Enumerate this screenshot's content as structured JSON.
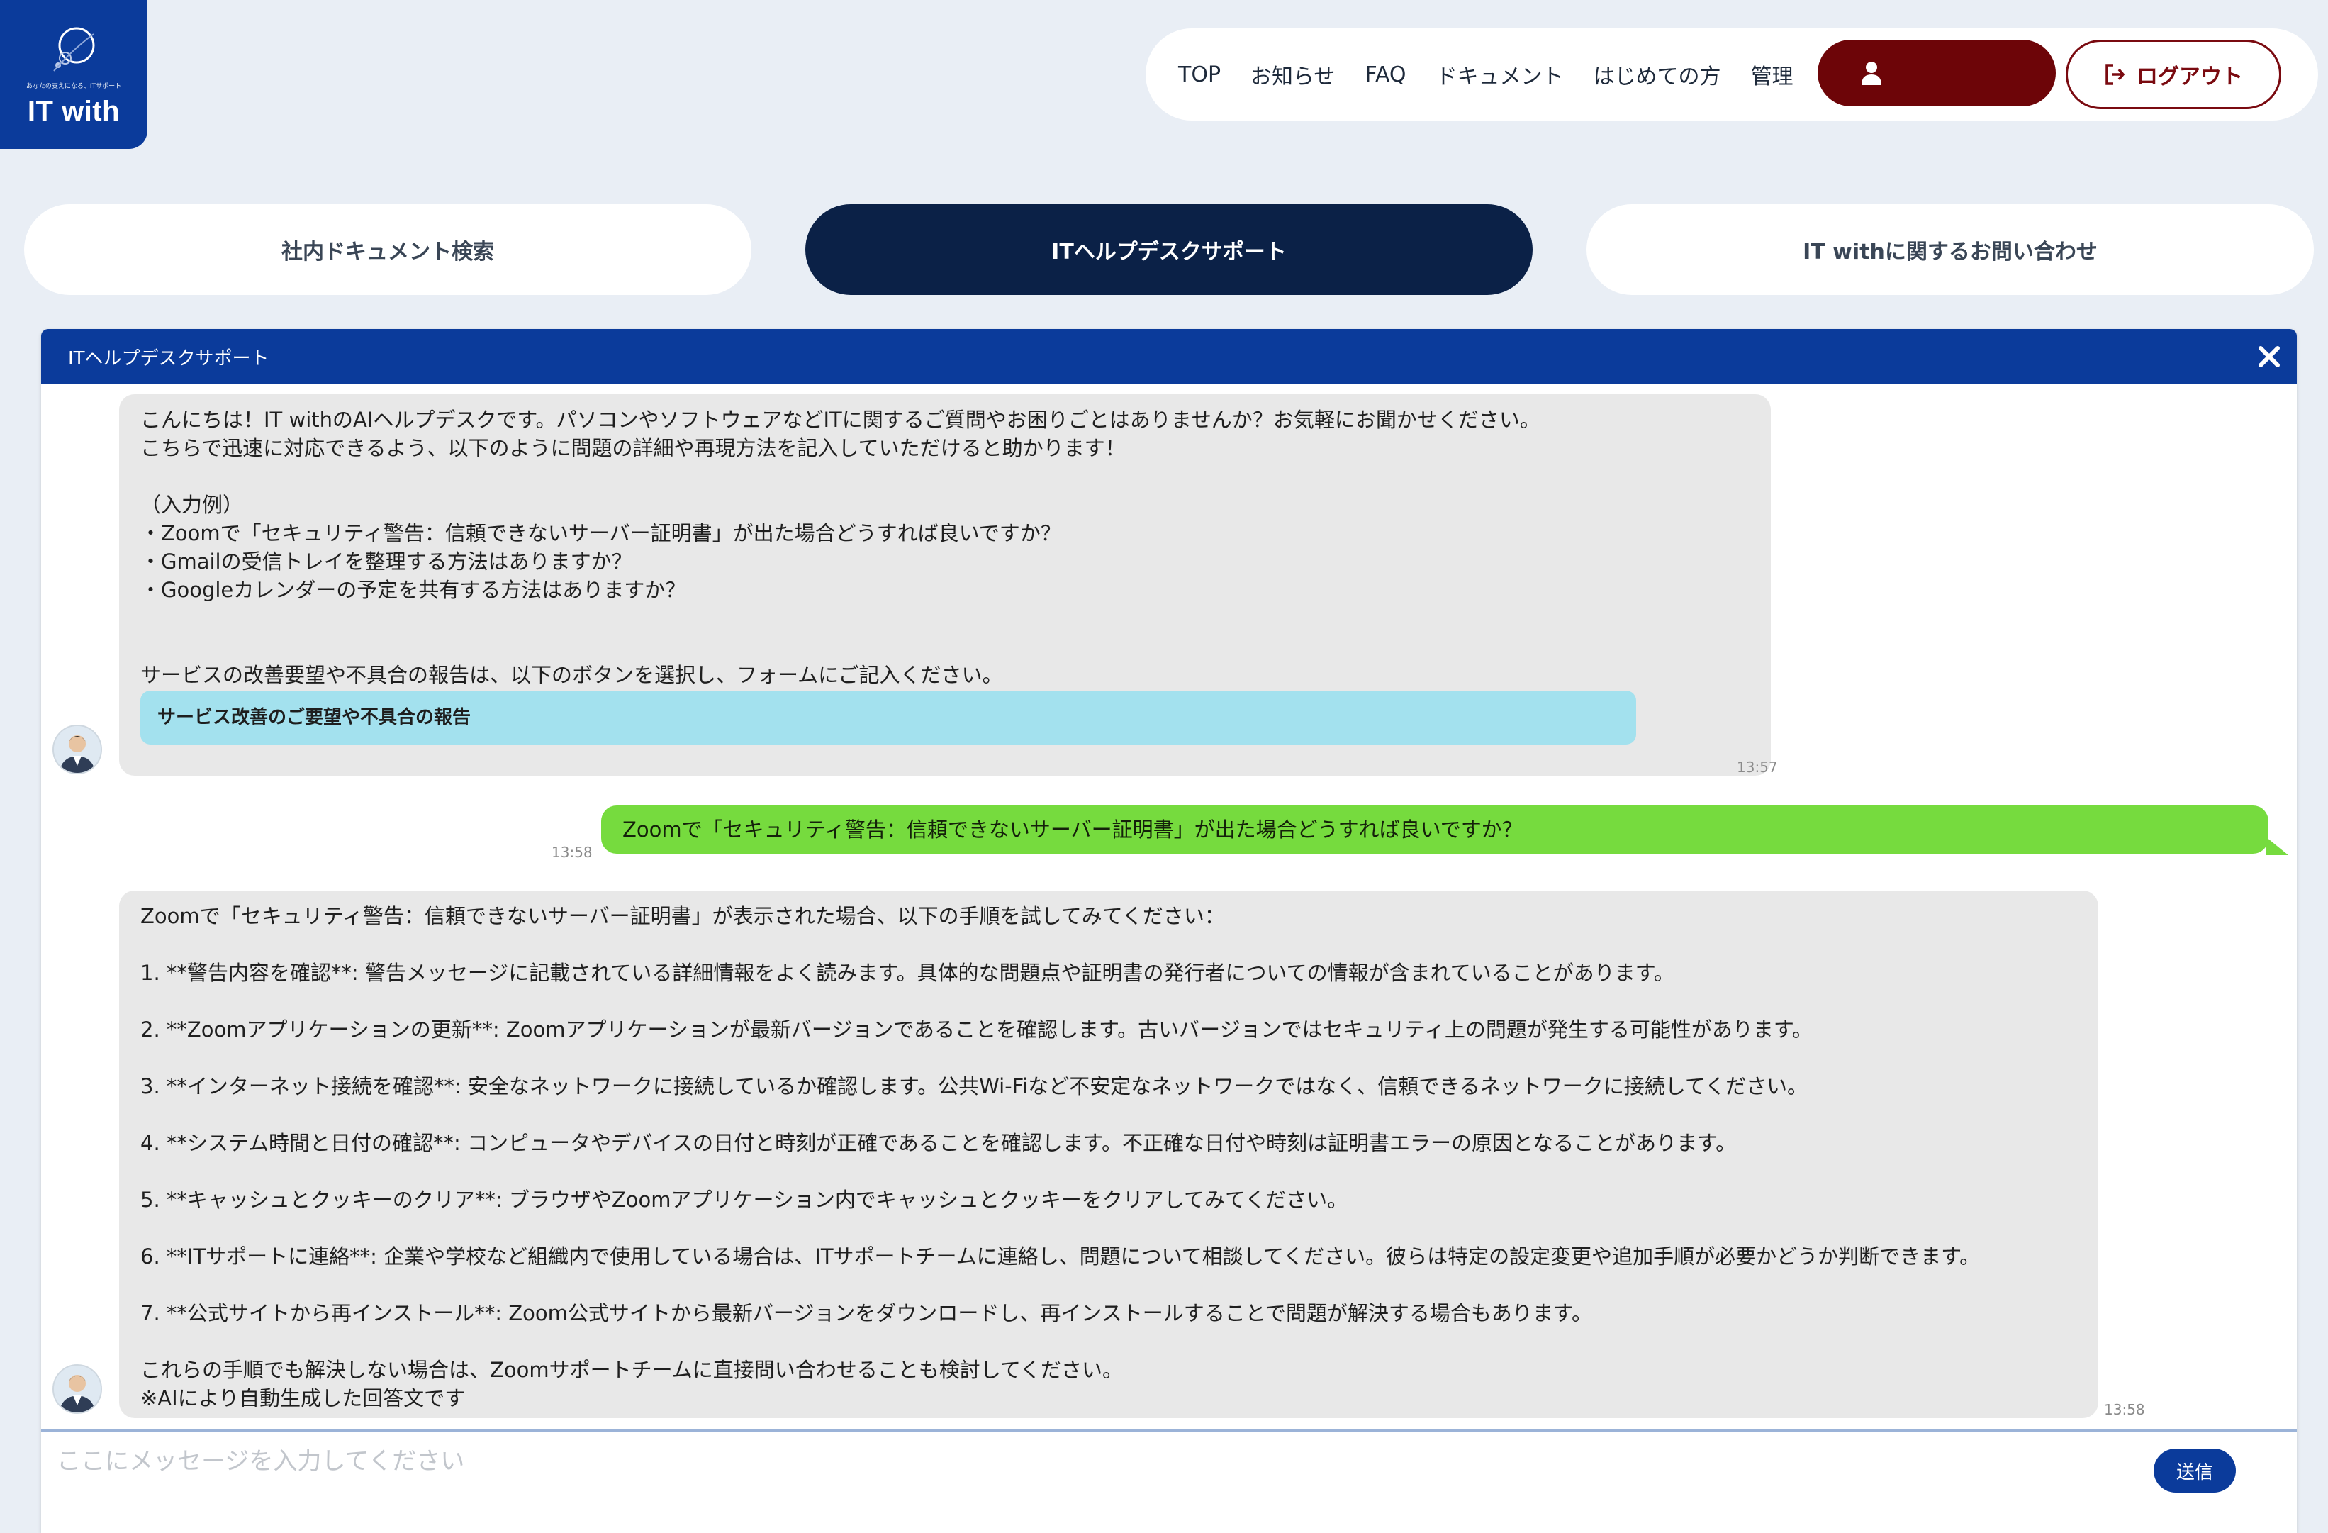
{
  "logo": {
    "tagline": "あなたの支えになる、ITサポート",
    "name": "IT with"
  },
  "nav": {
    "links": [
      "TOP",
      "お知らせ",
      "FAQ",
      "ドキュメント",
      "はじめての方",
      "管理"
    ],
    "logout_label": "ログアウト"
  },
  "tabs": [
    {
      "label": "社内ドキュメント検索",
      "active": false
    },
    {
      "label": "ITヘルプデスクサポート",
      "active": true
    },
    {
      "label": "IT withに関するお問い合わせ",
      "active": false
    }
  ],
  "chat": {
    "title": "ITヘルプデスクサポート",
    "messages": [
      {
        "role": "bot",
        "time": "13:57",
        "lines": [
          "こんにちは！IT withのAIヘルプデスクです。パソコンやソフトウェアなどITに関するご質問やお困りごとはありませんか？お気軽にお聞かせください。",
          "こちらで迅速に対応できるよう、以下のように問題の詳細や再現方法を記入していただけると助かります！",
          "",
          "（入力例）",
          "・Zoomで「セキュリティ警告：信頼できないサーバー証明書」が出た場合どうすれば良いですか？",
          "・Gmailの受信トレイを整理する方法はありますか？",
          "・Googleカレンダーの予定を共有する方法はありますか？",
          "",
          "",
          "サービスの改善要望や不具合の報告は、以下のボタンを選択し、フォームにご記入ください。"
        ],
        "button_label": "サービス改善のご要望や不具合の報告"
      },
      {
        "role": "user",
        "time": "13:58",
        "text": "Zoomで「セキュリティ警告：信頼できないサーバー証明書」が出た場合どうすれば良いですか？"
      },
      {
        "role": "bot",
        "time": "13:58",
        "lines": [
          "Zoomで「セキュリティ警告：信頼できないサーバー証明書」が表示された場合、以下の手順を試してみてください：",
          "",
          "1. **警告内容を確認**: 警告メッセージに記載されている詳細情報をよく読みます。具体的な問題点や証明書の発行者についての情報が含まれていることがあります。",
          "",
          "2. **Zoomアプリケーションの更新**: Zoomアプリケーションが最新バージョンであることを確認します。古いバージョンではセキュリティ上の問題が発生する可能性があります。",
          "",
          "3. **インターネット接続を確認**: 安全なネットワークに接続しているか確認します。公共Wi-Fiなど不安定なネットワークではなく、信頼できるネットワークに接続してください。",
          "",
          "4. **システム時間と日付の確認**: コンピュータやデバイスの日付と時刻が正確であることを確認します。不正確な日付や時刻は証明書エラーの原因となることがあります。",
          "",
          "5. **キャッシュとクッキーのクリア**: ブラウザやZoomアプリケーション内でキャッシュとクッキーをクリアしてみてください。",
          "",
          "6. **ITサポートに連絡**: 企業や学校など組織内で使用している場合は、ITサポートチームに連絡し、問題について相談してください。彼らは特定の設定変更や追加手順が必要かどうか判断できます。",
          "",
          "7. **公式サイトから再インストール**: Zoom公式サイトから最新バージョンをダウンロードし、再インストールすることで問題が解決する場合もあります。",
          "",
          "これらの手順でも解決しない場合は、Zoomサポートチームに直接問い合わせることも検討してください。",
          "※AIにより自動生成した回答文です"
        ]
      }
    ],
    "input_placeholder": "ここにメッセージを入力してください",
    "input_value": "",
    "send_label": "送信"
  },
  "colors": {
    "brand_blue": "#0b3b9b",
    "navy": "#0b2147",
    "logout_red": "#7a0a10",
    "user_bubble": "#76db3e",
    "bot_bubble": "#e8e8e8",
    "report_button": "#a3e1ee"
  },
  "icons": [
    "logo-mark-icon",
    "user-icon",
    "logout-icon",
    "close-icon",
    "avatar-icon"
  ]
}
